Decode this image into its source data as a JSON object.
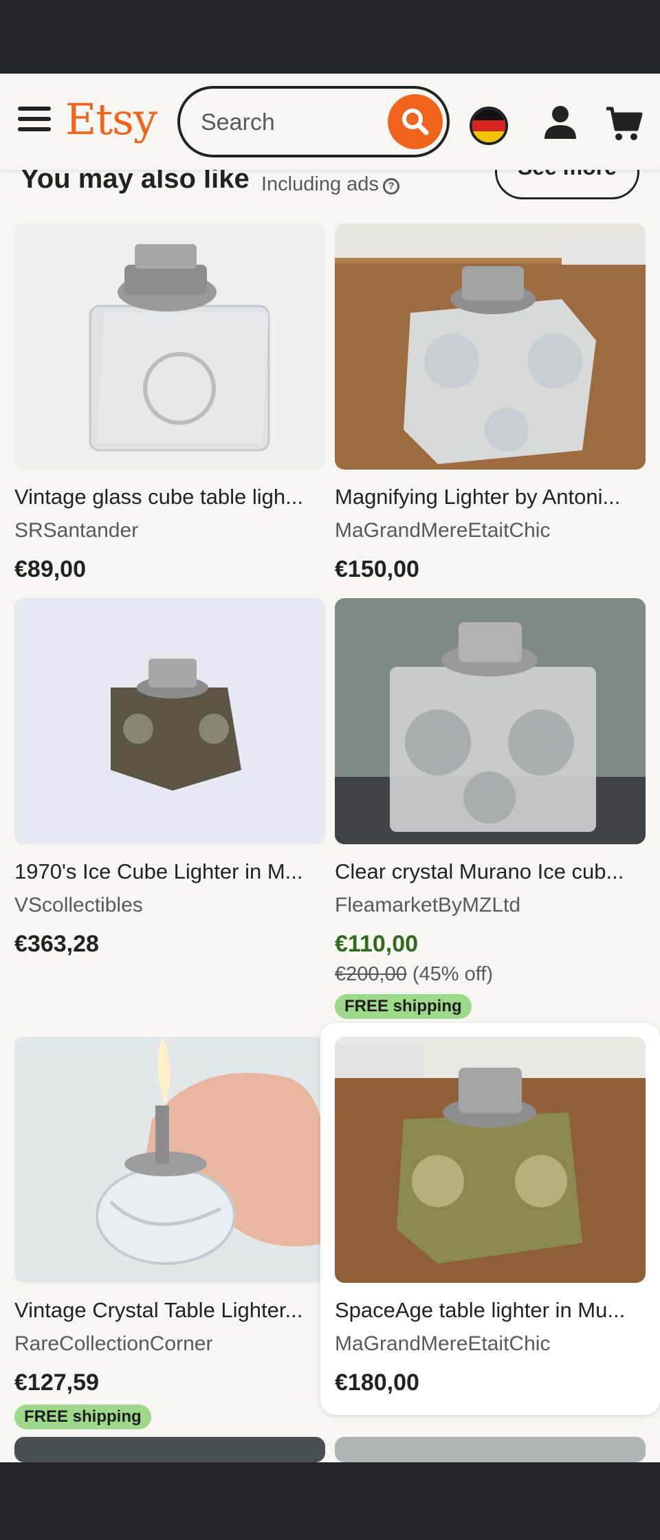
{
  "header": {
    "logo": "Etsy",
    "search_placeholder": "Search"
  },
  "section": {
    "title": "You may also like",
    "subtitle": "Including ads",
    "see_more": "See more"
  },
  "products": [
    {
      "title": "Vintage glass cube table ligh...",
      "shop": "SRSantander",
      "price": "€89,00"
    },
    {
      "title": "Magnifying Lighter by Antoni...",
      "shop": "MaGrandMereEtaitChic",
      "price": "€150,00"
    },
    {
      "title": "1970's Ice Cube Lighter in M...",
      "shop": "VScollectibles",
      "price": "€363,28"
    },
    {
      "title": "Clear crystal Murano Ice cub...",
      "shop": "FleamarketByMZLtd",
      "price": "€110,00",
      "original_price": "€200,00",
      "discount": "(45% off)",
      "shipping": "FREE shipping"
    },
    {
      "title": "Vintage Crystal Table Lighter...",
      "shop": "RareCollectionCorner",
      "price": "€127,59",
      "shipping": "FREE shipping"
    },
    {
      "title": "SpaceAge table lighter in Mu...",
      "shop": "MaGrandMereEtaitChic",
      "price": "€180,00"
    }
  ],
  "colors": {
    "brand": "#f1641e",
    "sale_price": "#2f6b1d",
    "free_shipping_badge": "#9ed88a"
  }
}
